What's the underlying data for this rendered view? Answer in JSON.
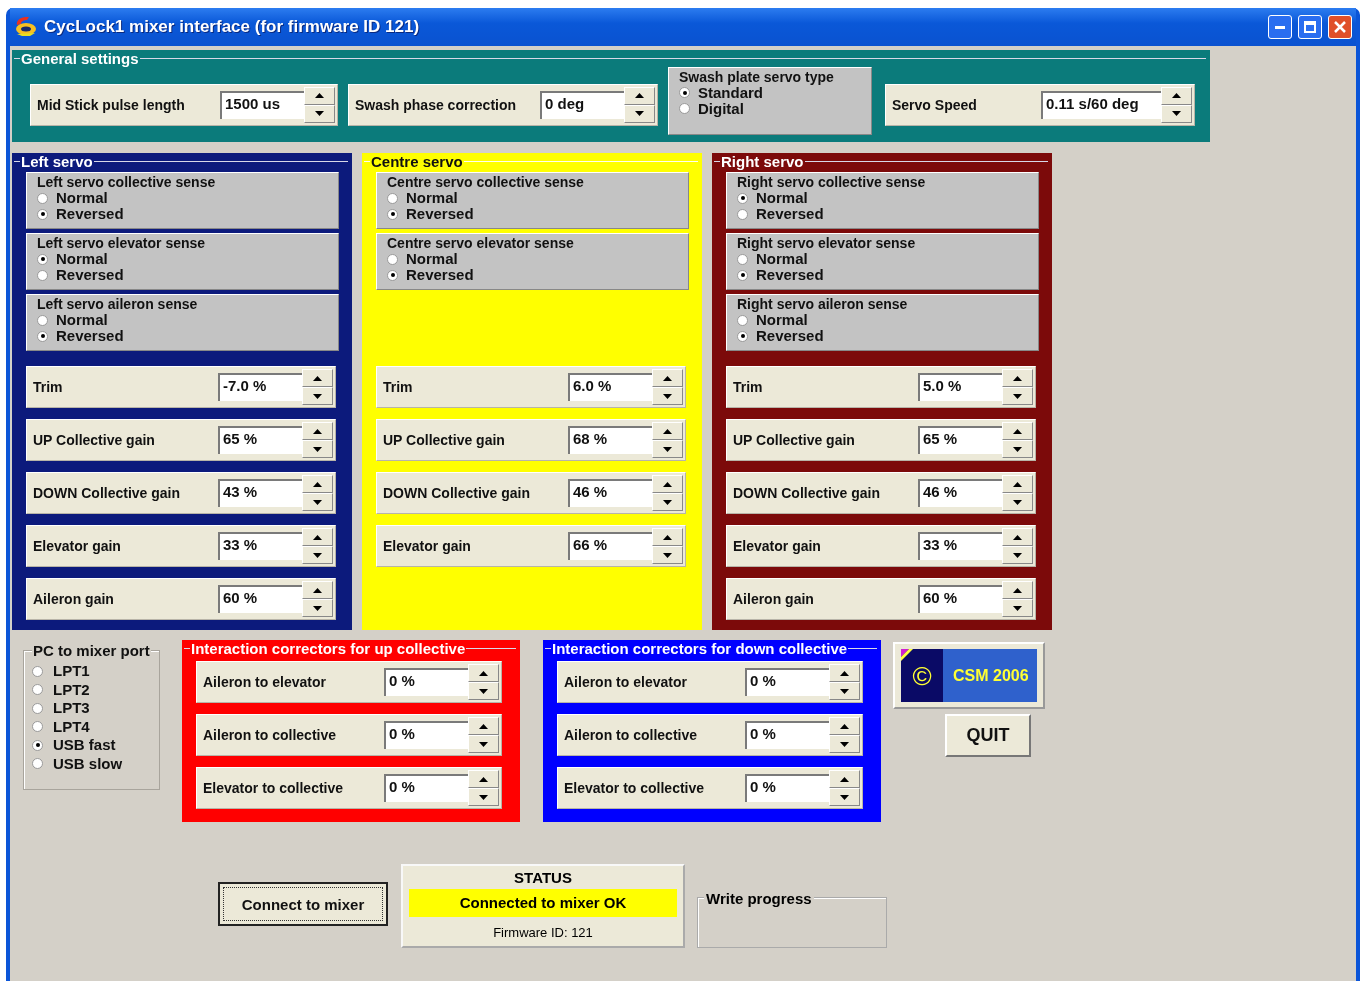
{
  "window": {
    "title": "CycLock1 mixer interface (for firmware ID 121)"
  },
  "general_settings": {
    "title": "General settings",
    "color": "#0b7b7b",
    "mid_stick": {
      "label": "Mid Stick pulse length",
      "value": "1500 us"
    },
    "swash_phase": {
      "label": "Swash phase correction",
      "value": "0 deg"
    },
    "servo_type": {
      "title": "Swash plate servo type",
      "options": [
        {
          "label": "Standard",
          "selected": true
        },
        {
          "label": "Digital",
          "selected": false
        }
      ]
    },
    "servo_speed": {
      "label": "Servo Speed",
      "value": "0.11 s/60 deg"
    }
  },
  "servos": [
    {
      "title": "Left servo",
      "color": "#0c1a7c",
      "senses": [
        {
          "title": "Left servo collective sense",
          "options": [
            {
              "label": "Normal",
              "selected": false
            },
            {
              "label": "Reversed",
              "selected": true
            }
          ]
        },
        {
          "title": "Left servo elevator sense",
          "options": [
            {
              "label": "Normal",
              "selected": true
            },
            {
              "label": "Reversed",
              "selected": false
            }
          ]
        },
        {
          "title": "Left servo aileron sense",
          "options": [
            {
              "label": "Normal",
              "selected": false
            },
            {
              "label": "Reversed",
              "selected": true
            }
          ]
        }
      ],
      "settings": [
        {
          "label": "Trim",
          "value": "-7.0 %"
        },
        {
          "label": "UP Collective gain",
          "value": "65 %"
        },
        {
          "label": "DOWN Collective gain",
          "value": "43 %"
        },
        {
          "label": "Elevator gain",
          "value": "33 %"
        },
        {
          "label": "Aileron gain",
          "value": "60 %"
        }
      ]
    },
    {
      "title": "Centre servo",
      "color": "#ffff00",
      "senses": [
        {
          "title": "Centre servo collective sense",
          "options": [
            {
              "label": "Normal",
              "selected": false
            },
            {
              "label": "Reversed",
              "selected": true
            }
          ]
        },
        {
          "title": "Centre servo elevator sense",
          "options": [
            {
              "label": "Normal",
              "selected": false
            },
            {
              "label": "Reversed",
              "selected": true
            }
          ]
        }
      ],
      "settings": [
        {
          "label": "Trim",
          "value": "6.0 %"
        },
        {
          "label": "UP Collective gain",
          "value": "68 %"
        },
        {
          "label": "DOWN Collective gain",
          "value": "46 %"
        },
        {
          "label": "Elevator gain",
          "value": "66 %"
        }
      ]
    },
    {
      "title": "Right servo",
      "color": "#7c0a0a",
      "senses": [
        {
          "title": "Right servo collective sense",
          "options": [
            {
              "label": "Normal",
              "selected": true
            },
            {
              "label": "Reversed",
              "selected": false
            }
          ]
        },
        {
          "title": "Right servo elevator sense",
          "options": [
            {
              "label": "Normal",
              "selected": false
            },
            {
              "label": "Reversed",
              "selected": true
            }
          ]
        },
        {
          "title": "Right servo aileron sense",
          "options": [
            {
              "label": "Normal",
              "selected": false
            },
            {
              "label": "Reversed",
              "selected": true
            }
          ]
        }
      ],
      "settings": [
        {
          "label": "Trim",
          "value": "5.0 %"
        },
        {
          "label": "UP Collective gain",
          "value": "65 %"
        },
        {
          "label": "DOWN Collective gain",
          "value": "46 %"
        },
        {
          "label": "Elevator gain",
          "value": "33 %"
        },
        {
          "label": "Aileron gain",
          "value": "60 %"
        }
      ]
    }
  ],
  "port": {
    "title": "PC to mixer port",
    "options": [
      {
        "label": "LPT1",
        "selected": false
      },
      {
        "label": "LPT2",
        "selected": false
      },
      {
        "label": "LPT3",
        "selected": false
      },
      {
        "label": "LPT4",
        "selected": false
      },
      {
        "label": "USB fast",
        "selected": true
      },
      {
        "label": "USB slow",
        "selected": false
      }
    ]
  },
  "correctors": [
    {
      "title": "Interaction correctors for up collective",
      "color": "#ff0000",
      "settings": [
        {
          "label": "Aileron to elevator",
          "value": "0 %"
        },
        {
          "label": "Aileron to collective",
          "value": "0 %"
        },
        {
          "label": "Elevator to collective",
          "value": "0 %"
        }
      ]
    },
    {
      "title": "Interaction correctors for down collective",
      "color": "#0000ff",
      "settings": [
        {
          "label": "Aileron to elevator",
          "value": "0 %"
        },
        {
          "label": "Aileron to collective",
          "value": "0 %"
        },
        {
          "label": "Elevator to collective",
          "value": "0 %"
        }
      ]
    }
  ],
  "logo": {
    "symbol": "©",
    "text": "CSM 2006"
  },
  "quit_button": "QUIT",
  "connect_button": "Connect to mixer",
  "status": {
    "title": "STATUS",
    "message": "Connected to mixer OK",
    "firmware": "Firmware ID: 121"
  },
  "write_progress": {
    "label": "Write progress"
  }
}
